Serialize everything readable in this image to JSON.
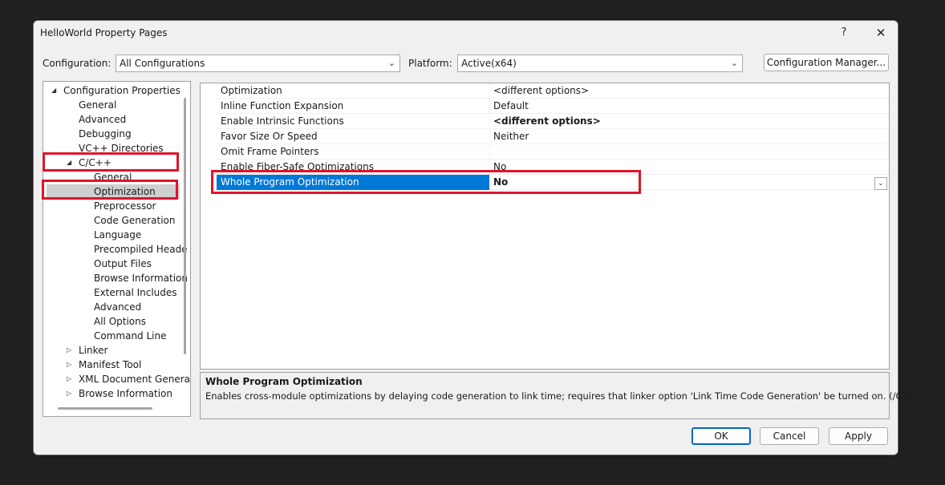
{
  "window": {
    "title": "HelloWorld Property Pages",
    "help_label": "?",
    "close_label": "✕"
  },
  "config_bar": {
    "configuration_label": "Configuration:",
    "configuration_value": "All Configurations",
    "platform_label": "Platform:",
    "platform_value": "Active(x64)",
    "manager_button": "Configuration Manager..."
  },
  "tree": {
    "root": "Configuration Properties",
    "items_level1": [
      "General",
      "Advanced",
      "Debugging",
      "VC++ Directories"
    ],
    "cpp": "C/C++",
    "cpp_children": [
      "General",
      "Optimization",
      "Preprocessor",
      "Code Generation",
      "Language",
      "Precompiled Heade",
      "Output Files",
      "Browse Information",
      "External Includes",
      "Advanced",
      "All Options",
      "Command Line"
    ],
    "collapsed": [
      "Linker",
      "Manifest Tool",
      "XML Document Genera",
      "Browse Information"
    ],
    "selected": "Optimization"
  },
  "grid": {
    "rows": [
      {
        "name": "Optimization",
        "value": "<different options>"
      },
      {
        "name": "Inline Function Expansion",
        "value": "Default"
      },
      {
        "name": "Enable Intrinsic Functions",
        "value": "<different options>"
      },
      {
        "name": "Favor Size Or Speed",
        "value": "Neither"
      },
      {
        "name": "Omit Frame Pointers",
        "value": ""
      },
      {
        "name": "Enable Fiber-Safe Optimizations",
        "value": "No"
      },
      {
        "name": "Whole Program Optimization",
        "value": "No"
      }
    ],
    "selected": "Whole Program Optimization"
  },
  "description": {
    "title": "Whole Program Optimization",
    "text": "Enables cross-module optimizations by delaying code generation to link time; requires that linker option 'Link Time Code Generation' be turned on.     (/GL)"
  },
  "buttons": {
    "ok": "OK",
    "cancel": "Cancel",
    "apply": "Apply"
  },
  "colors": {
    "selection": "#0078d7",
    "highlight": "#e0142b",
    "tree_selection": "#cfcfcf"
  }
}
